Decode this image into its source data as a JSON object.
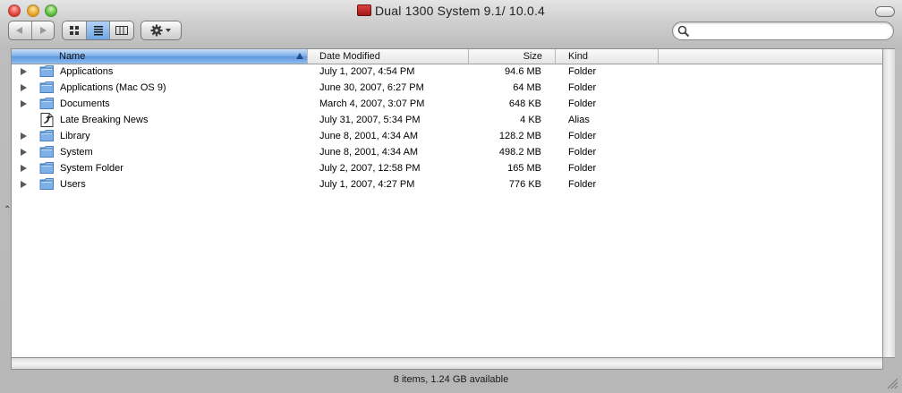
{
  "window": {
    "title": "Dual 1300 System 9.1/ 10.0.4"
  },
  "toolbar": {
    "back_icon": "back-arrow-icon",
    "forward_icon": "forward-arrow-icon",
    "view_modes": [
      "icon-view",
      "list-view",
      "column-view"
    ],
    "active_view": "list-view",
    "action_icon": "gear-icon"
  },
  "search": {
    "placeholder": "",
    "value": ""
  },
  "columns": {
    "name": "Name",
    "date": "Date Modified",
    "size": "Size",
    "kind": "Kind"
  },
  "rows": [
    {
      "name": "Applications",
      "date": "July 1, 2007, 4:54 PM",
      "size": "94.6 MB",
      "kind": "Folder",
      "icon": "folder-icon",
      "expandable": true
    },
    {
      "name": "Applications (Mac OS 9)",
      "date": "June 30, 2007, 6:27 PM",
      "size": "64 MB",
      "kind": "Folder",
      "icon": "folder-icon",
      "expandable": true
    },
    {
      "name": "Documents",
      "date": "March 4, 2007, 3:07 PM",
      "size": "648 KB",
      "kind": "Folder",
      "icon": "folder-icon",
      "expandable": true
    },
    {
      "name": "Late Breaking News",
      "date": "July 31, 2007, 5:34 PM",
      "size": "4 KB",
      "kind": "Alias",
      "icon": "alias-document-icon",
      "expandable": false
    },
    {
      "name": "Library",
      "date": "June 8, 2001, 4:34 AM",
      "size": "128.2 MB",
      "kind": "Folder",
      "icon": "folder-icon",
      "expandable": true
    },
    {
      "name": "System",
      "date": "June 8, 2001, 4:34 AM",
      "size": "498.2 MB",
      "kind": "Folder",
      "icon": "folder-icon",
      "expandable": true
    },
    {
      "name": "System Folder",
      "date": "July 2, 2007, 12:58 PM",
      "size": "165 MB",
      "kind": "Folder",
      "icon": "folder-icon",
      "expandable": true
    },
    {
      "name": "Users",
      "date": "July 1, 2007, 4:27 PM",
      "size": "776 KB",
      "kind": "Folder",
      "icon": "folder-icon",
      "expandable": true
    }
  ],
  "status": {
    "text": "8 items, 1.24 GB available"
  },
  "colors": {
    "selection_header": "#5d97e0",
    "folder": "#7fb0e6"
  }
}
